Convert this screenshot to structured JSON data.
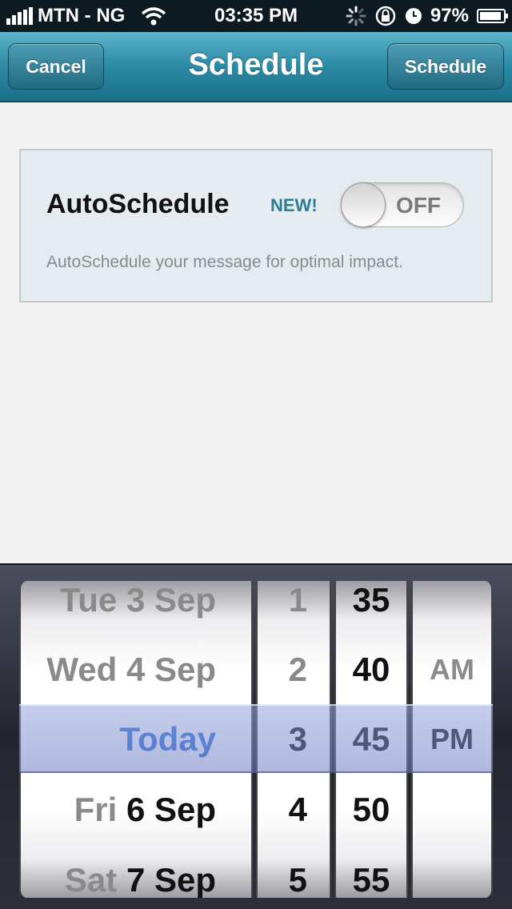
{
  "status_bar": {
    "carrier": "MTN - NG",
    "time": "03:35 PM",
    "battery": "97%",
    "signal_icon": "signal-bars-icon",
    "wifi_icon": "wifi-icon",
    "activity_icon": "activity-spinner-icon",
    "lock_icon": "rotation-lock-icon",
    "alarm_icon": "clock-icon",
    "battery_icon": "battery-charging-icon"
  },
  "nav": {
    "title": "Schedule",
    "left_button": "Cancel",
    "right_button": "Schedule"
  },
  "autoschedule": {
    "label": "AutoSchedule",
    "badge": "NEW!",
    "toggle_state": "OFF",
    "description": "AutoSchedule your message for optimal impact."
  },
  "picker": {
    "date_column": {
      "rows": [
        {
          "day": "Tue",
          "date": "3 Sep"
        },
        {
          "day": "Wed",
          "date": "4 Sep"
        },
        {
          "day": "",
          "date": "Today"
        },
        {
          "day": "Fri",
          "date": "6 Sep"
        },
        {
          "day": "Sat",
          "date": "7 Sep"
        }
      ],
      "selected_index": 2
    },
    "hour_column": {
      "rows": [
        "1",
        "2",
        "3",
        "4",
        "5"
      ],
      "selected_index": 2
    },
    "minute_column": {
      "rows": [
        "35",
        "40",
        "45",
        "50",
        "55"
      ],
      "selected_index": 2
    },
    "ampm_column": {
      "rows": [
        "AM",
        "PM"
      ],
      "selected_index": 1
    }
  },
  "colors": {
    "navbar": "#2b8aa4",
    "badge": "#2e7c94",
    "selected_today": "#2f6ed6",
    "card_bg": "#e5ecf0"
  }
}
